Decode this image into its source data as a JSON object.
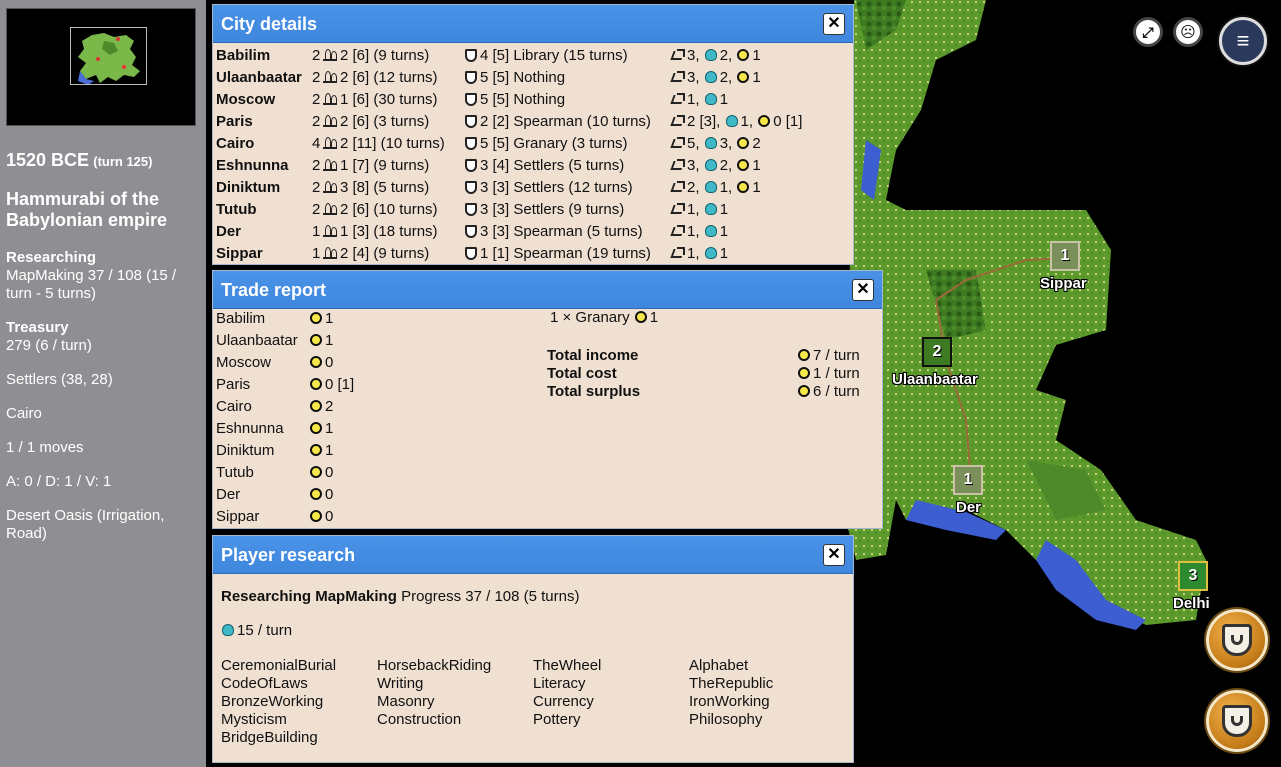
{
  "sidebar": {
    "date": "1520 BCE",
    "turn": "(turn 125)",
    "leader": "Hammurabi of the Babylonian empire",
    "research_heading": "Researching",
    "research_text": "MapMaking 37 / 108 (15 / turn - 5 turns)",
    "treasury_heading": "Treasury",
    "treasury_text": "279 (6 / turn)",
    "unit": "Settlers (38, 28)",
    "unit_city": "Cairo",
    "moves": "1 / 1 moves",
    "stats": "A: 0 / D: 1 / V: 1",
    "terrain": "Desert Oasis (Irrigation, Road)"
  },
  "city_details": {
    "title": "City details",
    "close": "✕",
    "rows": [
      {
        "name": "Babilim",
        "size": "2",
        "food": "2 [6] (9 turns)",
        "prod": "4 [5] Library (15 turns)",
        "trade": "3,",
        "sci": "2,",
        "gold": "1"
      },
      {
        "name": "Ulaanbaatar",
        "size": "2",
        "food": "2 [6] (12 turns)",
        "prod": "5 [5] Nothing",
        "trade": "3,",
        "sci": "2,",
        "gold": "1"
      },
      {
        "name": "Moscow",
        "size": "2",
        "food": "1 [6] (30 turns)",
        "prod": "5 [5] Nothing",
        "trade": "1,",
        "sci": "1",
        "gold": ""
      },
      {
        "name": "Paris",
        "size": "2",
        "food": "2 [6] (3 turns)",
        "prod": "2 [2] Spearman (10 turns)",
        "trade": "2 [3],",
        "sci": "1,",
        "gold": "0 [1]"
      },
      {
        "name": "Cairo",
        "size": "4",
        "food": "2 [11] (10 turns)",
        "prod": "5 [5] Granary (3 turns)",
        "trade": "5,",
        "sci": "3,",
        "gold": "2"
      },
      {
        "name": "Eshnunna",
        "size": "2",
        "food": "1 [7] (9 turns)",
        "prod": "3 [4] Settlers (5 turns)",
        "trade": "3,",
        "sci": "2,",
        "gold": "1"
      },
      {
        "name": "Diniktum",
        "size": "2",
        "food": "3 [8] (5 turns)",
        "prod": "3 [3] Settlers (12 turns)",
        "trade": "2,",
        "sci": "1,",
        "gold": "1"
      },
      {
        "name": "Tutub",
        "size": "2",
        "food": "2 [6] (10 turns)",
        "prod": "3 [3] Settlers (9 turns)",
        "trade": "1,",
        "sci": "1",
        "gold": ""
      },
      {
        "name": "Der",
        "size": "1",
        "food": "1 [3] (18 turns)",
        "prod": "3 [3] Spearman (5 turns)",
        "trade": "1,",
        "sci": "1",
        "gold": ""
      },
      {
        "name": "Sippar",
        "size": "1",
        "food": "2 [4] (9 turns)",
        "prod": "1 [1] Spearman (19 turns)",
        "trade": "1,",
        "sci": "1",
        "gold": ""
      }
    ]
  },
  "trade_report": {
    "title": "Trade report",
    "close": "✕",
    "rows": [
      {
        "city": "Babilim",
        "value": "1"
      },
      {
        "city": "Ulaanbaatar",
        "value": "1"
      },
      {
        "city": "Moscow",
        "value": "0"
      },
      {
        "city": "Paris",
        "value": "0 [1]"
      },
      {
        "city": "Cairo",
        "value": "2"
      },
      {
        "city": "Eshnunna",
        "value": "1"
      },
      {
        "city": "Diniktum",
        "value": "1"
      },
      {
        "city": "Tutub",
        "value": "0"
      },
      {
        "city": "Der",
        "value": "0"
      },
      {
        "city": "Sippar",
        "value": "0"
      }
    ],
    "upkeep_item": "1 × Granary",
    "upkeep_value": "1",
    "total_income_label": "Total income",
    "total_income": "7 / turn",
    "total_cost_label": "Total cost",
    "total_cost": "1 / turn",
    "total_surplus_label": "Total surplus",
    "total_surplus": "6 / turn"
  },
  "player_research": {
    "title": "Player research",
    "close": "✕",
    "researching_label": "Researching MapMaking",
    "progress": "Progress 37 / 108 (5 turns)",
    "bulbs": "15 / turn",
    "techs": [
      [
        "CeremonialBurial",
        "CodeOfLaws",
        "BronzeWorking",
        "Mysticism",
        "BridgeBuilding"
      ],
      [
        "HorsebackRiding",
        "Writing",
        "Masonry",
        "Construction"
      ],
      [
        "TheWheel",
        "Literacy",
        "Currency",
        "Pottery"
      ],
      [
        "Alphabet",
        "TheRepublic",
        "IronWorking",
        "Philosophy"
      ]
    ]
  },
  "map": {
    "cities": [
      {
        "name": "Sippar",
        "size": "1"
      },
      {
        "name": "Ulaanbaatar",
        "size": "2"
      },
      {
        "name": "Der",
        "size": "1"
      },
      {
        "name": "Delhi",
        "size": "3"
      }
    ]
  },
  "colors": {
    "titlebar": "#3f86dd",
    "dialog_bg": "#f0e0d2",
    "sidebar_bg": "#8f8f93",
    "grass": "#5c9a2c",
    "ocean": "#3c5ed0"
  }
}
